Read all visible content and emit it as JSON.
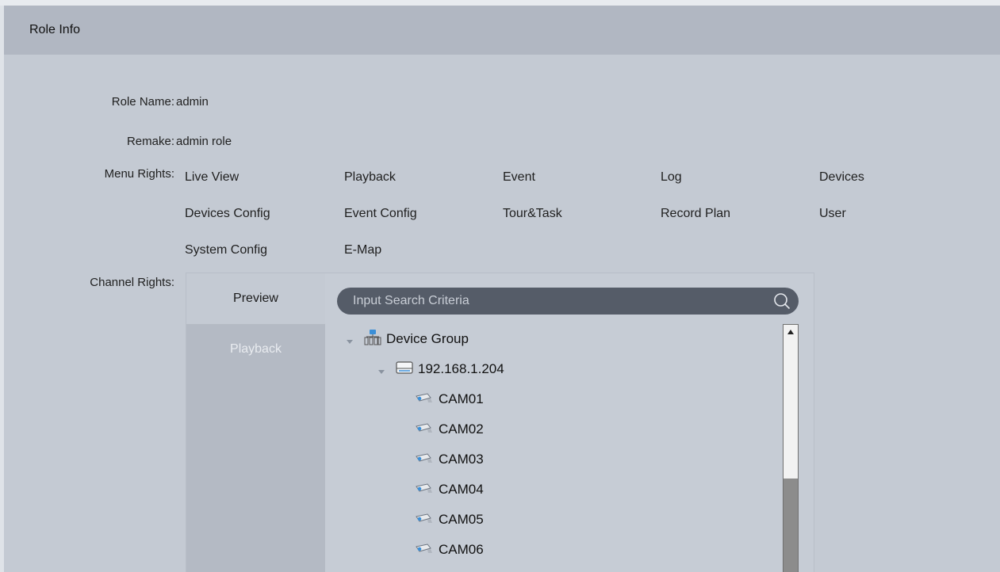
{
  "header": {
    "title": "Role Info"
  },
  "fields": {
    "role_name_label": "Role Name:",
    "role_name_value": "admin",
    "remake_label": "Remake:",
    "remake_value": "admin role",
    "menu_rights_label": "Menu Rights:",
    "channel_rights_label": "Channel Rights:"
  },
  "menu_rights": [
    "Live View",
    "Playback",
    "Event",
    "Log",
    "Devices",
    "Devices Config",
    "Event Config",
    "Tour&Task",
    "Record Plan",
    "User",
    "System Config",
    "E-Map"
  ],
  "channel_tabs": [
    {
      "label": "Preview",
      "active": true
    },
    {
      "label": "Playback",
      "active": false
    }
  ],
  "search": {
    "placeholder": "Input Search Criteria",
    "icon": "search-icon"
  },
  "tree": {
    "root": {
      "label": "Device Group",
      "icon": "device-group-icon",
      "expanded": true
    },
    "device": {
      "label": "192.168.1.204",
      "icon": "dvr-icon",
      "expanded": true
    },
    "channels": [
      "CAM01",
      "CAM02",
      "CAM03",
      "CAM04",
      "CAM05",
      "CAM06"
    ],
    "channel_icon": "camera-icon"
  },
  "colors": {
    "header_bg": "#b1b7c2",
    "page_bg": "#c4cad3",
    "search_bg": "#555c68"
  }
}
